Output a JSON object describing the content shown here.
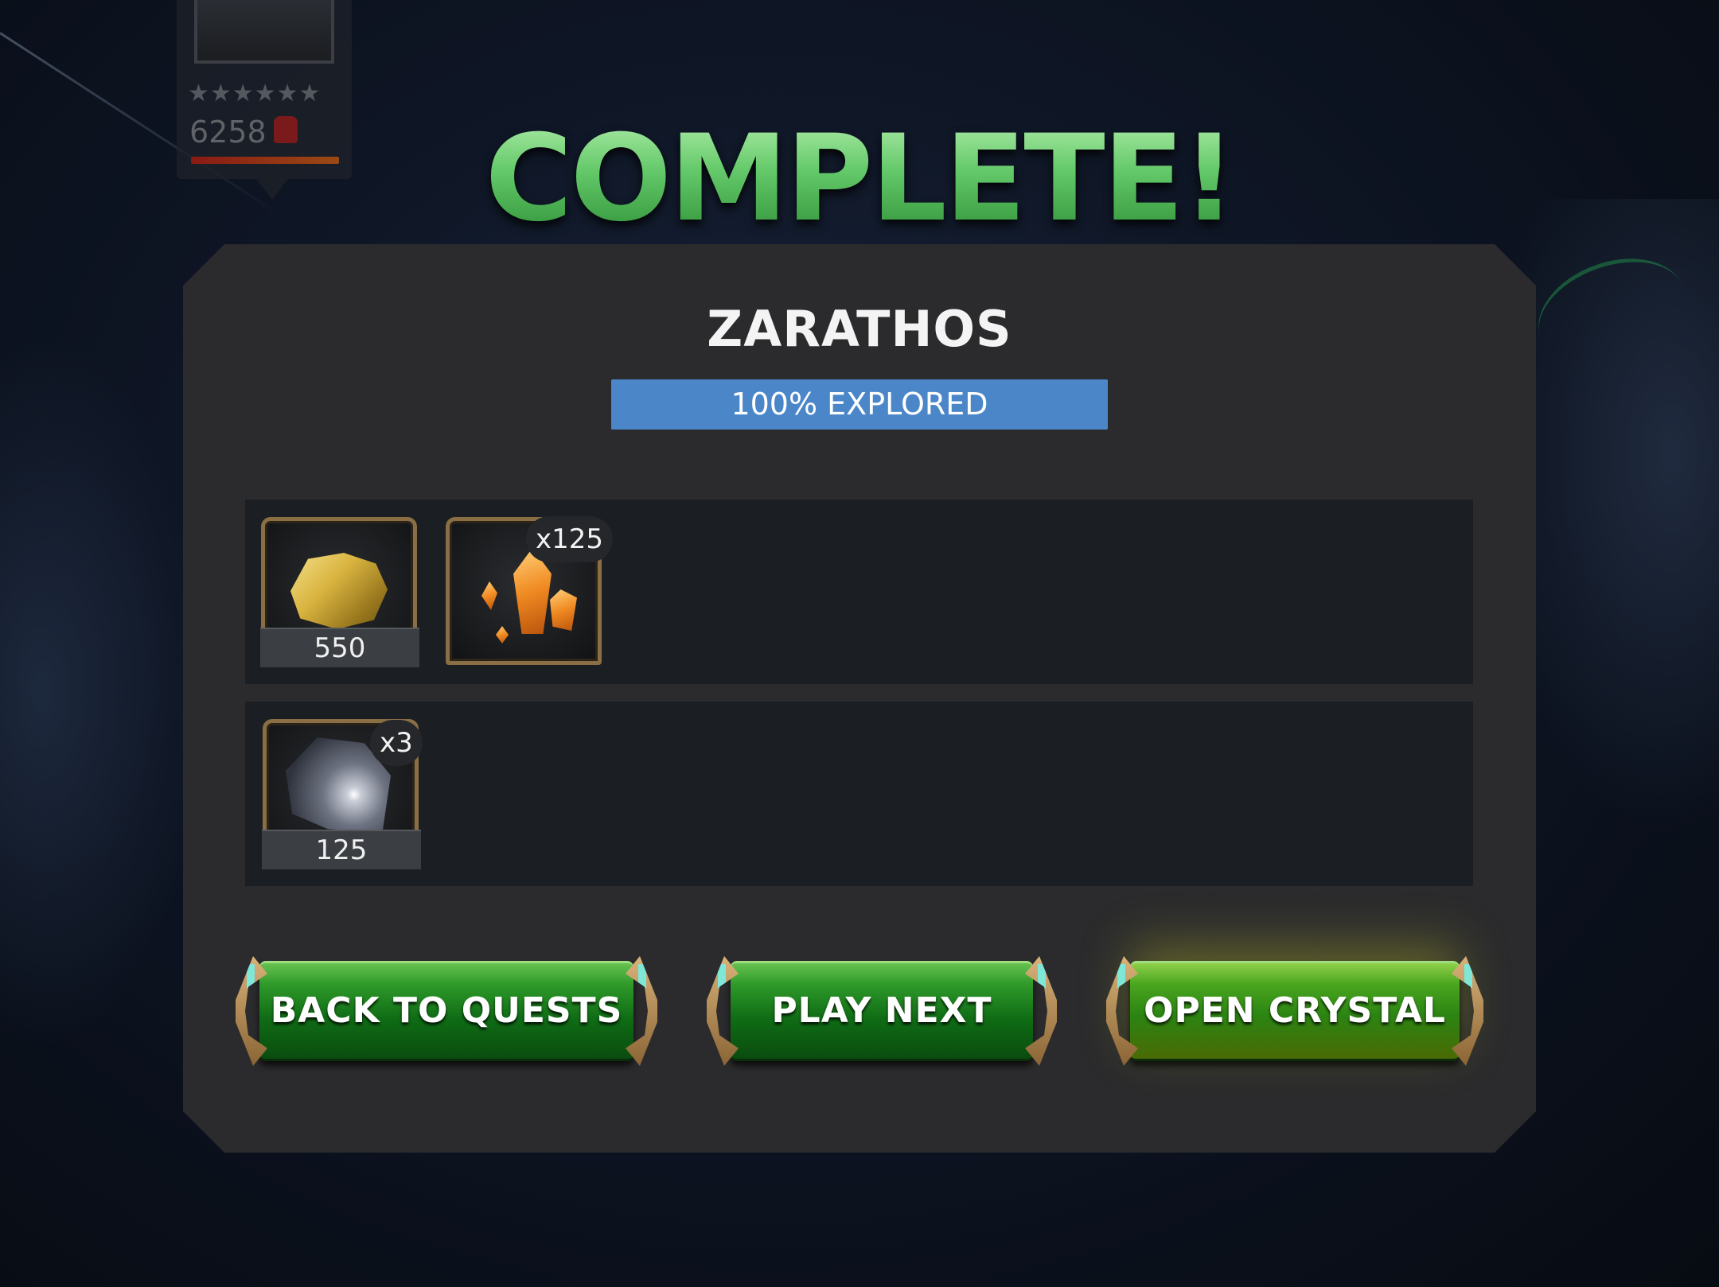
{
  "champion_card": {
    "stars": "★★★★★★",
    "rating": "6258"
  },
  "title": "COMPLETE!",
  "panel": {
    "region_name": "ZARATHOS",
    "explored_text": "100% EXPLORED",
    "explored_percent": 100
  },
  "rewards": {
    "row1": [
      {
        "icon": "gold-icon",
        "label": "550"
      },
      {
        "icon": "crystal-shard-icon",
        "badge": "x125"
      }
    ],
    "row2": [
      {
        "icon": "premium-crystal-icon",
        "label": "125",
        "badge": "x3"
      }
    ]
  },
  "buttons": {
    "back": "BACK TO QUESTS",
    "play_next": "PLAY NEXT",
    "open_crystal": "OPEN CRYSTAL"
  },
  "colors": {
    "title_green": "#5ec46c",
    "panel": "#2b2b2d",
    "explored_bar": "#4a86c8",
    "button_green": "#0f6c15"
  }
}
